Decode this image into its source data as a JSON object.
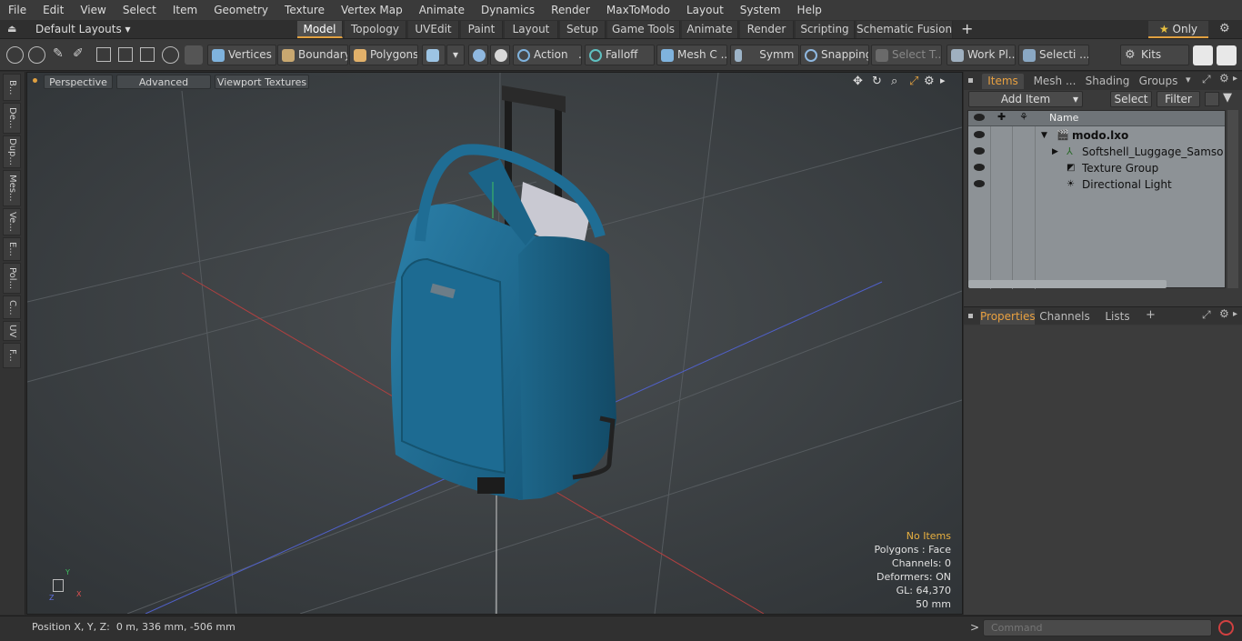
{
  "menubar": {
    "items": [
      "File",
      "Edit",
      "View",
      "Select",
      "Item",
      "Geometry",
      "Texture",
      "Vertex Map",
      "Animate",
      "Dynamics",
      "Render",
      "MaxToModo",
      "Layout",
      "System",
      "Help"
    ]
  },
  "layout_bar": {
    "preset": "Default Layouts",
    "tabs": [
      "Model",
      "Topology",
      "UVEdit",
      "Paint",
      "Layout",
      "Setup",
      "Game Tools",
      "Animate",
      "Render",
      "Scripting",
      "Schematic Fusion"
    ],
    "active_tab": "Model",
    "add": "+",
    "only_label": "Only"
  },
  "toolbar": {
    "vertices": "Vertices",
    "boundary": "Boundary",
    "polygons": "Polygons",
    "action": "Action",
    "falloff": "Falloff",
    "mesh": "Mesh C ...",
    "symmetry": "Symm ...",
    "snapping": "Snapping",
    "select_t": "Select T...",
    "work_plane": "Work Pl...",
    "selection": "Selecti ...",
    "kits": "Kits",
    "ellipsis": "..."
  },
  "left_strip": {
    "tabs": [
      "B...",
      "De...",
      "Dup...",
      "Mes...",
      "Ve...",
      "E...",
      "Pol...",
      "C...",
      "UV",
      "F..."
    ]
  },
  "viewport": {
    "tabs": {
      "perspective": "Perspective",
      "advanced": "Advanced",
      "textures": "Viewport Textures"
    },
    "info": {
      "items": "No Items",
      "polygons": "Polygons : Face",
      "channels": "Channels: 0",
      "deformers": "Deformers: ON",
      "gl": "GL: 64,370",
      "scale": "50 mm"
    },
    "axis": {
      "y": "Y",
      "x": "X",
      "z": "Z"
    },
    "colors": {
      "bag": "#1f6d94",
      "bag_dark": "#164f6e",
      "grid": "#4d5256"
    }
  },
  "statusbar": {
    "position_label": "Position X, Y, Z:",
    "position_value": "0 m, 336 mm, -506 mm",
    "command_prompt": ">",
    "command_placeholder": "Command"
  },
  "items_panel": {
    "tabs": [
      "Items",
      "Mesh ...",
      "Shading",
      "Groups"
    ],
    "active": "Items",
    "add_item": "Add Item",
    "select": "Select",
    "filter": "Filter",
    "column_name": "Name",
    "tree": [
      {
        "label": "modo.lxo",
        "depth": 0,
        "bold": true
      },
      {
        "label": "Softshell_Luggage_Samsonit ...",
        "depth": 1
      },
      {
        "label": "Texture Group",
        "depth": 1
      },
      {
        "label": "Directional Light",
        "depth": 1
      }
    ]
  },
  "properties_panel": {
    "tabs": [
      "Properties",
      "Channels",
      "Lists"
    ],
    "active": "Properties",
    "add": "+"
  }
}
